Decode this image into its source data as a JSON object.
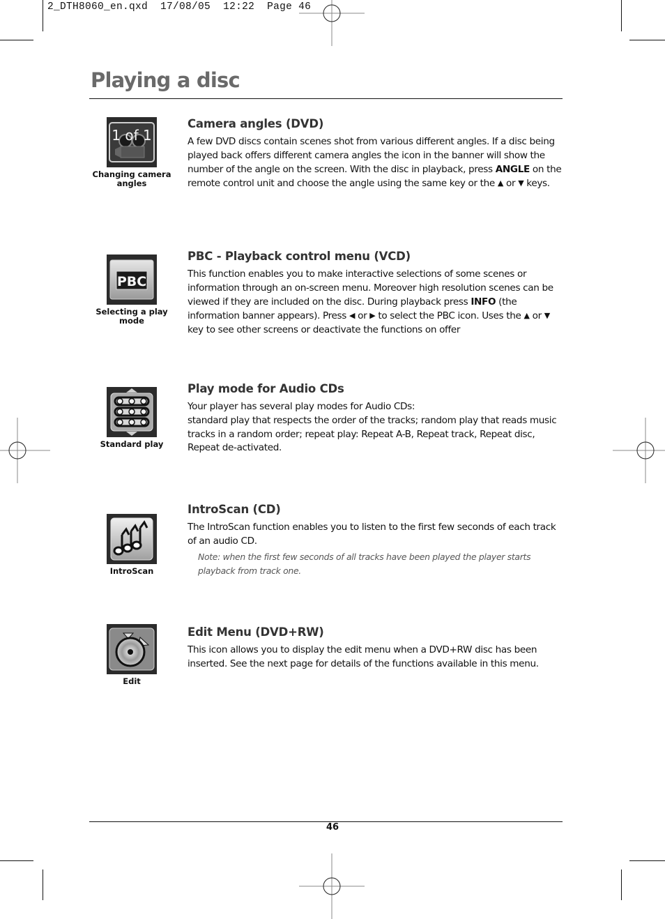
{
  "slug": {
    "filename": "2_DTH8060_en.qxd",
    "date": "17/08/05",
    "time": "12:22",
    "page_label": "Page 46"
  },
  "page": {
    "title": "Playing a disc",
    "number": "46"
  },
  "sections": [
    {
      "icon": "camera-angle-icon",
      "icon_text": "1 of 1",
      "caption": "Changing camera angles",
      "heading": "Camera angles (DVD)",
      "body_parts": {
        "p1": "A few DVD discs contain scenes shot from various different angles. If a disc being played back offers different camera angles the icon in the banner will show the number of the angle on the screen. With the disc in playback, press ",
        "bold1": "ANGLE",
        "p2": " on the remote control unit and choose the angle using the same key or the ",
        "up": "▲",
        "or": " or ",
        "down": "▼",
        "p3": " keys."
      }
    },
    {
      "icon": "pbc-icon",
      "icon_text": "PBC",
      "caption": "Selecting a play mode",
      "heading": "PBC - Playback control menu (VCD)",
      "body_parts": {
        "p1": "This function enables you to make interactive selections of some scenes or information through an on-screen menu. Moreover high resolution scenes can be viewed if they are included on the disc. During playback press ",
        "bold1": "INFO",
        "p2": " (the information banner appears). Press ",
        "left": "◀",
        "or1": " or ",
        "right": "▶",
        "p3": " to select the PBC icon. Uses the ",
        "up": "▲",
        "or2": " or ",
        "down": "▼",
        "p4": " key to see other screens or deactivate the functions on offer"
      }
    },
    {
      "icon": "standard-play-icon",
      "caption": "Standard play",
      "heading": "Play mode for Audio CDs",
      "body_lines": [
        "Your player has several play modes for Audio CDs:",
        "standard play that respects the order of the tracks; random play that reads music tracks in a random order; repeat play: Repeat A-B, Repeat track, Repeat disc, Repeat de-activated."
      ]
    },
    {
      "icon": "introscan-music-notes-icon",
      "caption": "IntroScan",
      "heading": "IntroScan (CD)",
      "body": "The IntroScan function enables you to listen to the first few seconds of each track of an audio CD.",
      "note": "Note: when the first few seconds of all tracks have been played the player starts playback from track one."
    },
    {
      "icon": "edit-disc-icon",
      "caption": "Edit",
      "heading": "Edit Menu (DVD+RW)",
      "body": "This icon allows you to display the edit menu when a DVD+RW disc has been inserted. See the next page for details of the functions available in this menu."
    }
  ],
  "colors": {
    "title": "#6a6a6a",
    "heading": "#333333",
    "note": "#555555",
    "icon_bg": "#2a2a2a"
  }
}
